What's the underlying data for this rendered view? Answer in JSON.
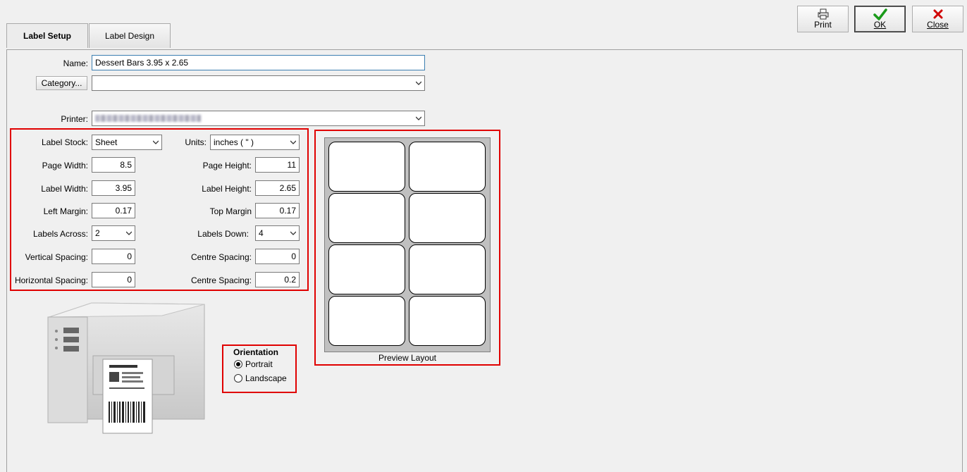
{
  "tabs": [
    {
      "label": "Label Setup",
      "active": true
    },
    {
      "label": "Label Design",
      "active": false
    }
  ],
  "toolbar": {
    "print_label": "Print",
    "ok_label": "OK",
    "close_label": "Close",
    "ok_icon": "checkmark-icon",
    "close_icon": "x-icon",
    "print_icon": "printer-icon"
  },
  "form": {
    "name_label": "Name:",
    "name_value": "Dessert Bars 3.95 x 2.65",
    "category_button": "Category...",
    "category_value": "",
    "printer_label": "Printer:",
    "label_stock_label": "Label Stock:",
    "label_stock_value": "Sheet",
    "units_label": "Units:",
    "units_value": "inches ( \" )",
    "page_width_label": "Page Width:",
    "page_width_value": "8.5",
    "page_height_label": "Page Height:",
    "page_height_value": "11",
    "label_width_label": "Label Width:",
    "label_width_value": "3.95",
    "label_height_label": "Label Height:",
    "label_height_value": "2.65",
    "left_margin_label": "Left Margin:",
    "left_margin_value": "0.17",
    "top_margin_label": "Top Margin",
    "top_margin_value": "0.17",
    "labels_across_label": "Labels Across:",
    "labels_across_value": "2",
    "labels_down_label": "Labels Down:",
    "labels_down_value": "4",
    "vertical_spacing_label": "Vertical Spacing:",
    "vertical_spacing_value": "0",
    "centre_spacing_v_label": "Centre Spacing:",
    "centre_spacing_v_value": "0",
    "horizontal_spacing_label": "Horizontal Spacing:",
    "horizontal_spacing_value": "0",
    "centre_spacing_h_label": "Centre Spacing:",
    "centre_spacing_h_value": "0.2"
  },
  "orientation": {
    "title": "Orientation",
    "options": [
      {
        "label": "Portrait",
        "selected": true
      },
      {
        "label": "Landscape",
        "selected": false
      }
    ]
  },
  "preview": {
    "caption": "Preview Layout"
  },
  "colors": {
    "highlight": "#e00000",
    "ok_check": "#1a9a1a",
    "close_x": "#d00000"
  }
}
